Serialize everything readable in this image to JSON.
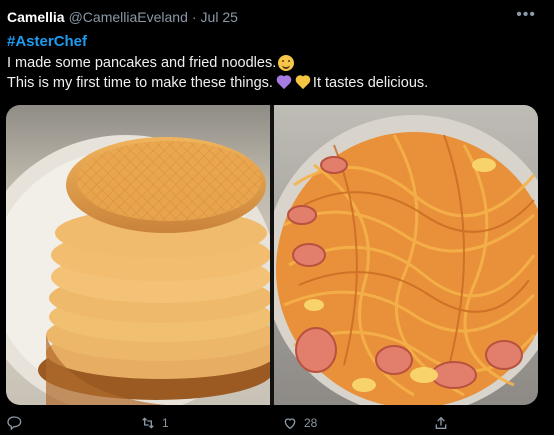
{
  "tweet": {
    "display_name": "Camellia",
    "handle": "@CamelliaEveland",
    "separator": "·",
    "time": "Jul 25",
    "more": "•••",
    "hashtag": "#AsterChef",
    "line1": "I made some pancakes and fried noodles.",
    "line2_a": "This is my first time to make these things.",
    "line2_b": "It tastes delicious.",
    "emoji_line1": "smiling-face-icon",
    "emoji_line2": [
      "purple-heart-icon",
      "yellow-heart-icon"
    ]
  },
  "media": {
    "images": [
      {
        "subject": "pancakes"
      },
      {
        "subject": "fried noodles with sausage"
      }
    ]
  },
  "actions": {
    "reply_count": "",
    "retweet_count": "1",
    "like_count": "28",
    "share_count": ""
  },
  "colors": {
    "background": "#000000",
    "text": "#e7e9ea",
    "muted": "#8b98a5",
    "hashtag": "#1d9bf0"
  }
}
